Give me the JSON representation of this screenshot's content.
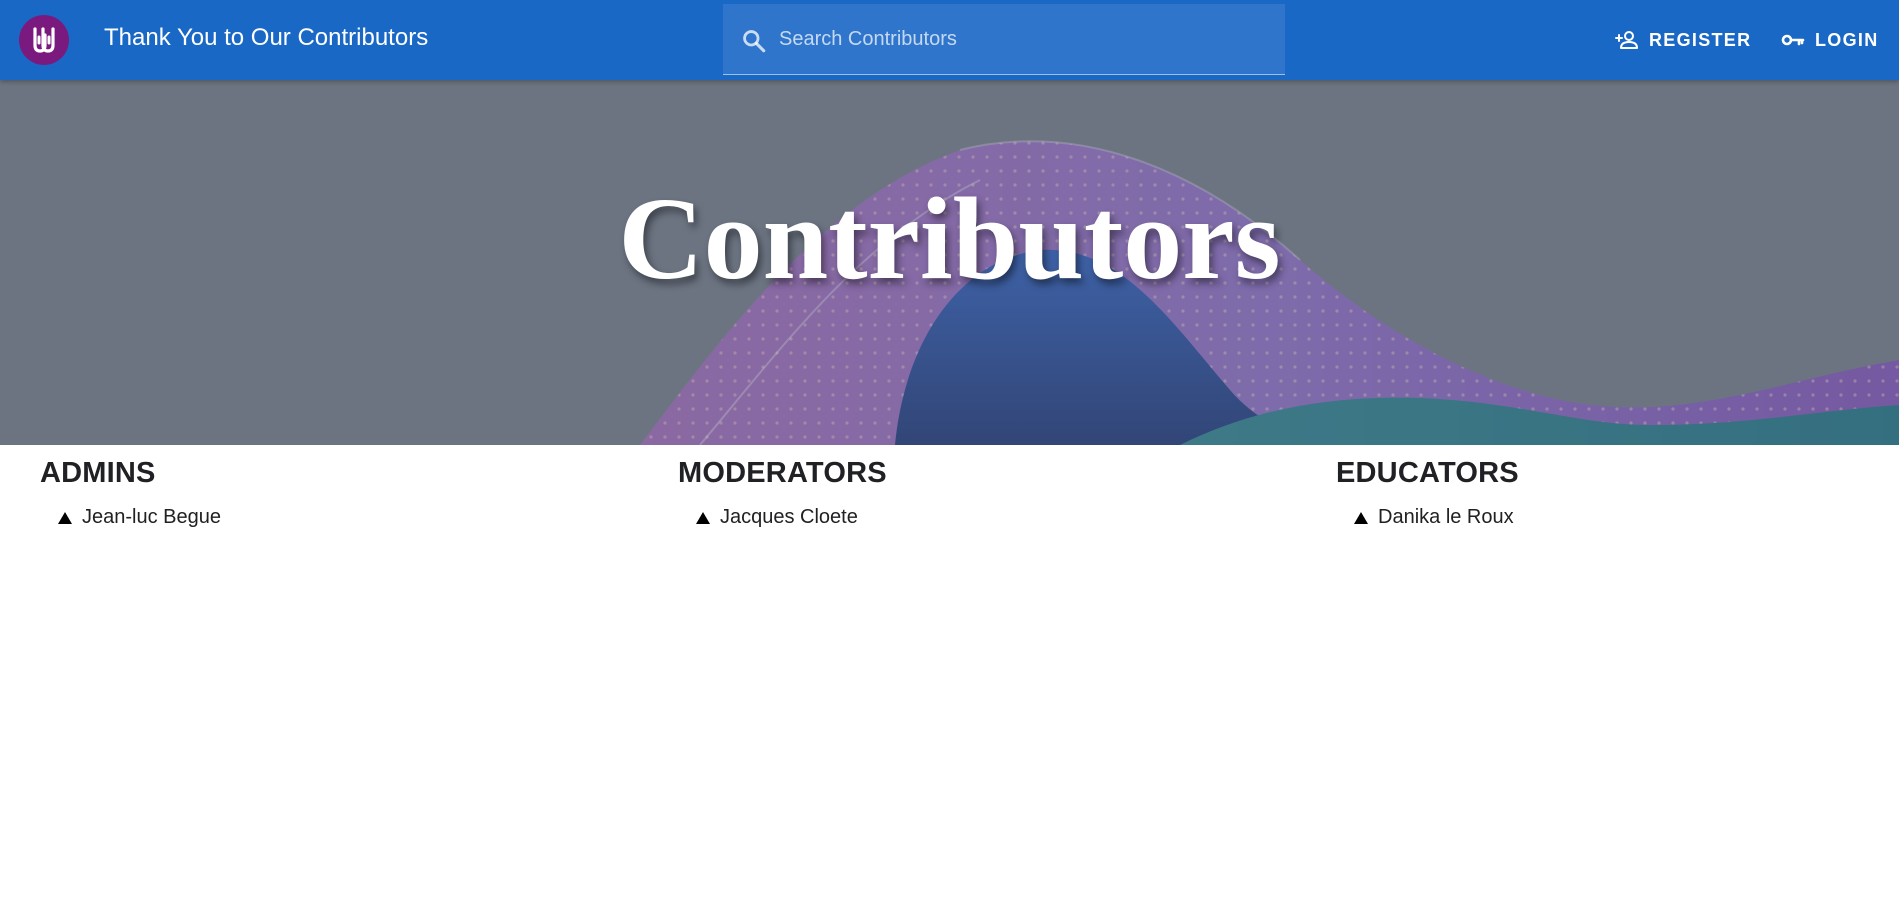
{
  "header": {
    "title": "Thank You to Our Contributors",
    "search": {
      "placeholder": "Search Contributors",
      "value": ""
    },
    "register_label": "REGISTER",
    "login_label": "LOGIN",
    "icons": {
      "logo": "site-logo",
      "search": "search-icon",
      "register": "person-add-icon",
      "login": "key-icon"
    }
  },
  "hero": {
    "title": "Contributors"
  },
  "groups": [
    {
      "heading": "ADMINS",
      "members": [
        "Jean-luc Begue"
      ]
    },
    {
      "heading": "MODERATORS",
      "members": [
        "Jacques Cloete"
      ]
    },
    {
      "heading": "EDUCATORS",
      "members": [
        "Danika le Roux"
      ]
    }
  ],
  "colors": {
    "appbar": "#1a68c6",
    "logo": "#7b1a7e",
    "text": "#202124"
  }
}
